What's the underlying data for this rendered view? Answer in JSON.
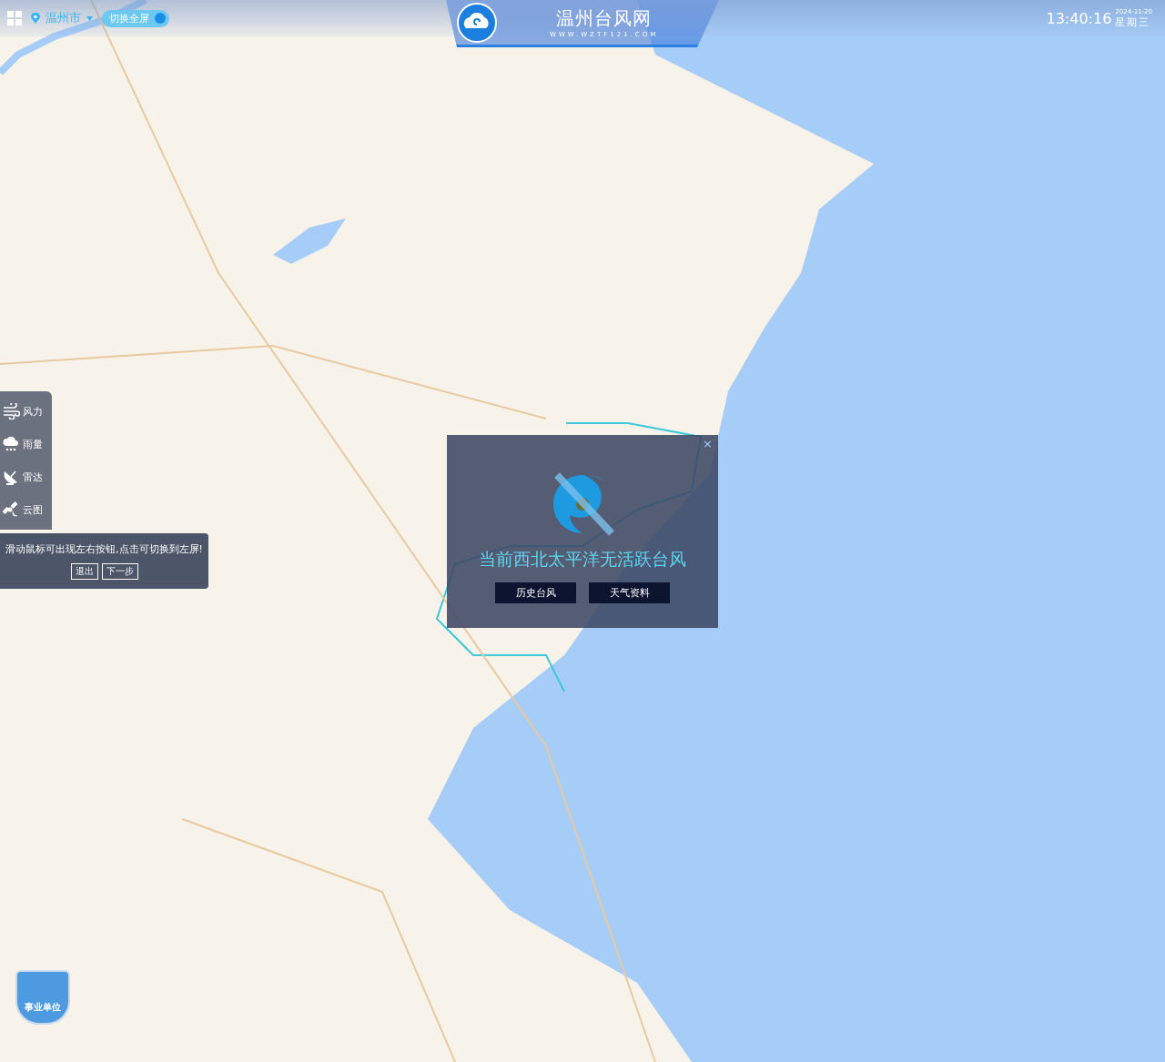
{
  "header": {
    "city": "温州市",
    "fullscreen_toggle": {
      "label": "切换全屏",
      "on": true
    },
    "site_title": "温州台风网",
    "site_url": "WWW.WZTF121.COM",
    "time": "13:40:16",
    "date": "2024-11-20",
    "weekday": "星期三"
  },
  "layer_menu": [
    {
      "kind": "wind",
      "label": "风力"
    },
    {
      "kind": "rain",
      "label": "雨量"
    },
    {
      "kind": "radar",
      "label": "雷达"
    },
    {
      "kind": "satellite",
      "label": "云图"
    }
  ],
  "guide_tip": {
    "text": "滑动鼠标可出现左右按钮,点击可切换到左屏!",
    "buttons": [
      "退出",
      "下一步"
    ]
  },
  "typhoon_dialog": {
    "close": "×",
    "message": "当前西北太平洋无活跃台风",
    "buttons": [
      "历史台风",
      "天气资料"
    ]
  },
  "badge": {
    "label": "事业单位"
  }
}
